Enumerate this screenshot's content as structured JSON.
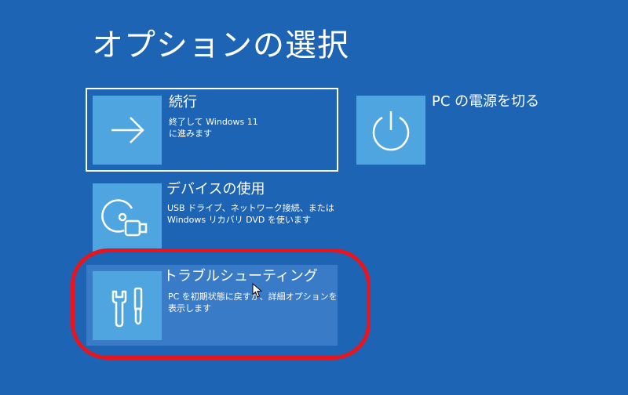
{
  "page": {
    "title": "オプションの選択"
  },
  "options": {
    "continue": {
      "title": "続行",
      "description": "終了して Windows 11\nに進みます",
      "icon": "arrow-right-icon"
    },
    "power_off": {
      "title": "PC の電源を切る",
      "icon": "power-icon"
    },
    "use_device": {
      "title": "デバイスの使用",
      "description": "USB ドライブ、ネットワーク接続、または\nWindows リカバリ DVD を使います",
      "icon": "disc-usb-icon"
    },
    "troubleshoot": {
      "title": "トラブルシューティング",
      "description": "PC を初期状態に戻すか、詳細オプションを\n表示します",
      "icon": "wrench-screwdriver-icon"
    }
  },
  "colors": {
    "background": "#1e64b4",
    "icon_tile": "#4ea5e0",
    "hover_tile": "#3a7bc8",
    "annotation_ring": "#e8141e"
  }
}
